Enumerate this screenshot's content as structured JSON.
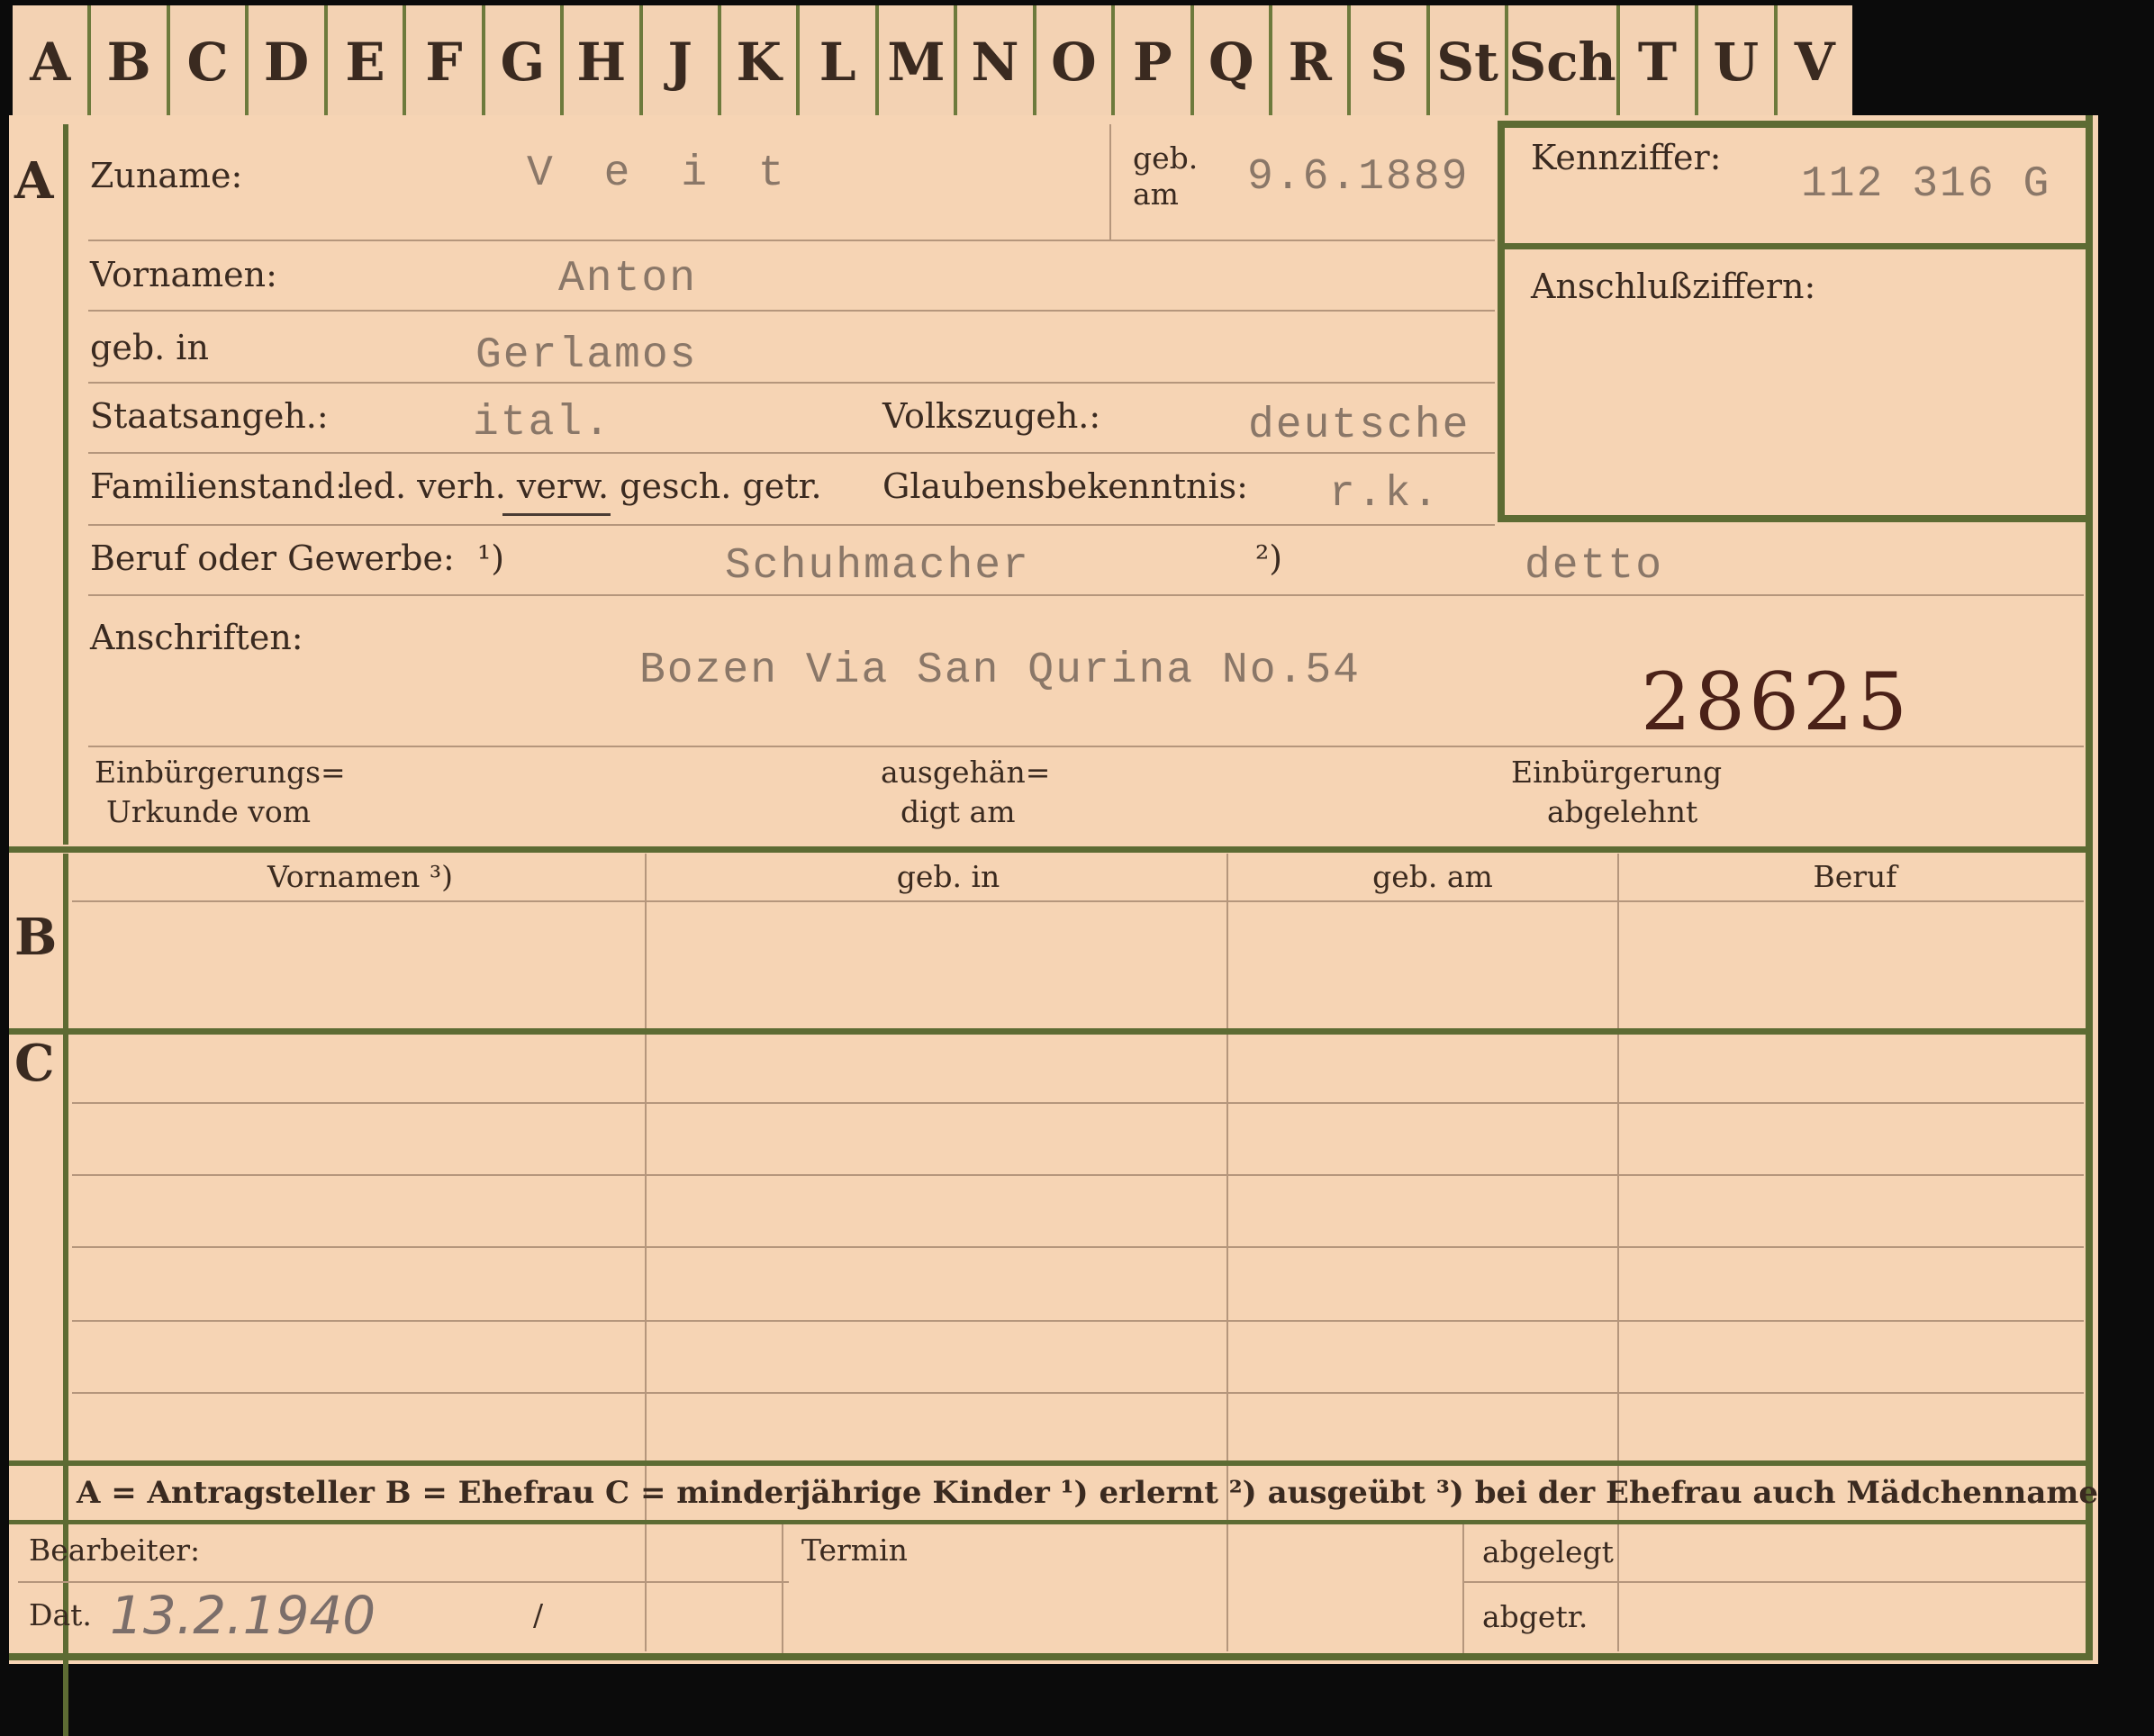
{
  "tabs": [
    "A",
    "B",
    "C",
    "D",
    "E",
    "F",
    "G",
    "H",
    "J",
    "K",
    "L",
    "M",
    "N",
    "O",
    "P",
    "Q",
    "R",
    "S",
    "St",
    "Sch",
    "T",
    "U",
    "V"
  ],
  "sections": {
    "a": "A",
    "b": "B",
    "c": "C"
  },
  "labels": {
    "zuname": "Zuname:",
    "geb_am_1": "geb.",
    "geb_am_2": "am",
    "kennziffer": "Kennziffer:",
    "anschlussziffern": "Anschlußziffern:",
    "vornamen": "Vornamen:",
    "geb_in": "geb. in",
    "staatsangeh": "Staatsangeh.:",
    "volkszugeh": "Volkszugeh.:",
    "familienstand": "Familienstand:",
    "familienstand_options": "led. verh. verw. gesch. getr.",
    "glaubensbekenntnis": "Glaubensbekenntnis:",
    "beruf": "Beruf oder Gewerbe:",
    "beruf_note1": "¹)",
    "beruf_note2": "²)",
    "anschriften": "Anschriften:",
    "einbuergerung_urkunde_1": "Einbürgerungs=",
    "einbuergerung_urkunde_2": "Urkunde vom",
    "ausgehaendigt_1": "ausgehän=",
    "ausgehaendigt_2": "digt am",
    "einbuergerung_abgelehnt_1": "Einbürgerung",
    "einbuergerung_abgelehnt_2": "abgelehnt"
  },
  "values": {
    "zuname": "V e i t",
    "geb_am": "9.6.1889",
    "kennziffer": "112 316  G",
    "vornamen": "Anton",
    "geb_in": "Gerlamos",
    "staatsangeh": "ital.",
    "volkszugeh": "deutsche",
    "glaubensbekenntnis": "r.k.",
    "beruf_erlernt": "Schuhmacher",
    "beruf_ausgeuebt": "detto",
    "anschrift": "Bozen Via San Qurina No.54",
    "stamp_number": "28625"
  },
  "table_b_headers": [
    "Vornamen ³)",
    "geb. in",
    "geb. am",
    "Beruf"
  ],
  "legend": "A = Antragsteller   B = Ehefrau   C = minderjährige Kinder   ¹) erlernt   ²) ausgeübt   ³) bei der Ehefrau auch Mädchenname",
  "footer": {
    "bearbeiter": "Bearbeiter:",
    "dat": "Dat.",
    "dat_value": "13.2.1940",
    "slash": "/",
    "termin": "Termin",
    "abgelegt": "abgelegt",
    "abgetr": "abgetr."
  }
}
